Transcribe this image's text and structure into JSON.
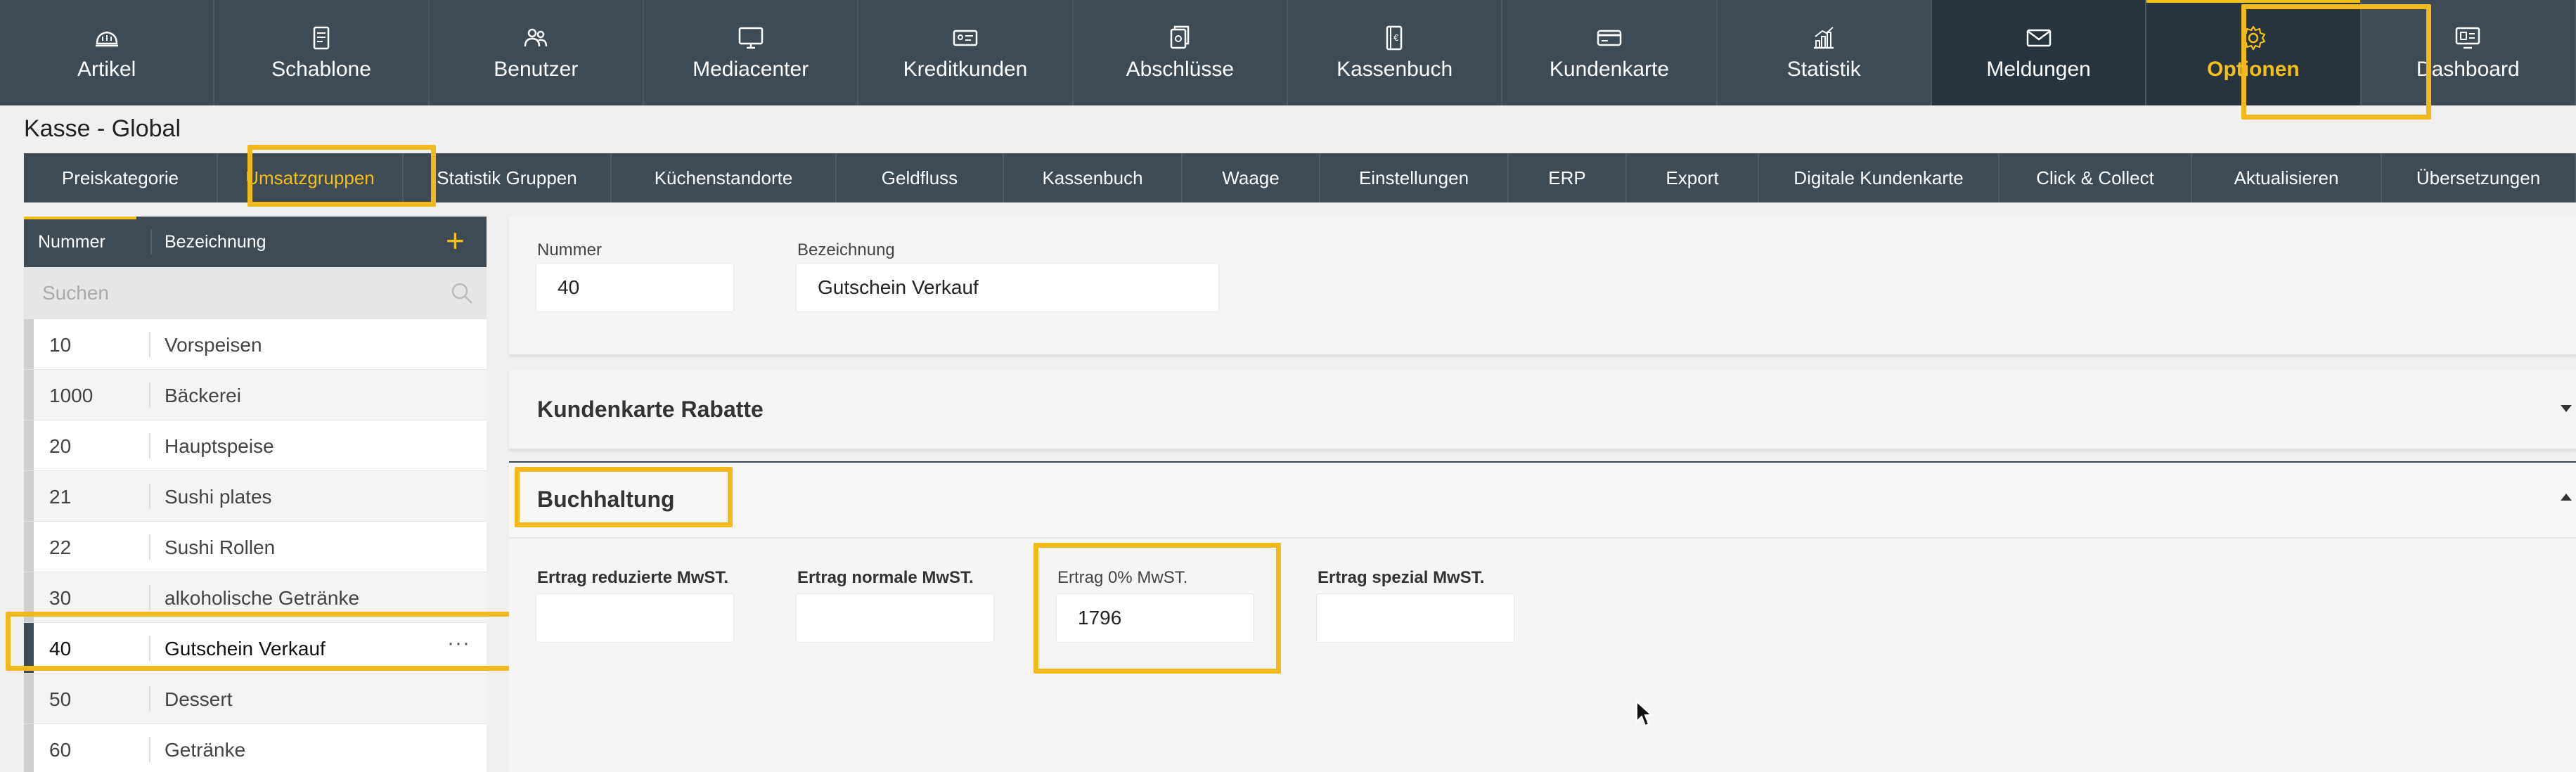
{
  "topnav": {
    "items": [
      {
        "label": "Artikel",
        "icon": "bread-icon"
      },
      {
        "label": "Schablone",
        "icon": "template-icon"
      },
      {
        "label": "Benutzer",
        "icon": "users-icon"
      },
      {
        "label": "Mediacenter",
        "icon": "monitor-icon"
      },
      {
        "label": "Kreditkunden",
        "icon": "id-card-icon"
      },
      {
        "label": "Abschlüsse",
        "icon": "files-icon"
      },
      {
        "label": "Kassenbuch",
        "icon": "cashbook-icon"
      },
      {
        "label": "Kundenkarte",
        "icon": "card-icon"
      },
      {
        "label": "Statistik",
        "icon": "chart-icon"
      },
      {
        "label": "Meldungen",
        "icon": "envelope-icon"
      },
      {
        "label": "Optionen",
        "icon": "gear-icon"
      },
      {
        "label": "Dashboard",
        "icon": "dashboard-icon"
      }
    ],
    "active_index": 10
  },
  "page_title": "Kasse - Global",
  "subtabs": [
    "Preiskategorie",
    "Umsatzgruppen",
    "Statistik Gruppen",
    "Küchenstandorte",
    "Geldfluss",
    "Kassenbuch",
    "Waage",
    "Einstellungen",
    "ERP",
    "Export",
    "Digitale Kundenkarte",
    "Click & Collect",
    "Aktualisieren",
    "Übersetzungen"
  ],
  "subtabs_active_index": 1,
  "list": {
    "header_number": "Nummer",
    "header_name": "Bezeichnung",
    "add_label": "+",
    "search_placeholder": "Suchen",
    "rows": [
      {
        "number": "10",
        "name": "Vorspeisen"
      },
      {
        "number": "1000",
        "name": "Bäckerei"
      },
      {
        "number": "20",
        "name": "Hauptspeise"
      },
      {
        "number": "21",
        "name": "Sushi plates"
      },
      {
        "number": "22",
        "name": "Sushi Rollen"
      },
      {
        "number": "30",
        "name": "alkoholische Getränke"
      },
      {
        "number": "40",
        "name": "Gutschein Verkauf"
      },
      {
        "number": "50",
        "name": "Dessert"
      },
      {
        "number": "60",
        "name": "Getränke"
      }
    ],
    "selected_index": 6,
    "row_menu": "···"
  },
  "detail": {
    "number_label": "Nummer",
    "number_value": "40",
    "name_label": "Bezeichnung",
    "name_value": "Gutschein Verkauf"
  },
  "kundenkarte": {
    "title": "Kundenkarte Rabatte"
  },
  "buchhaltung": {
    "title": "Buchhaltung",
    "fields": [
      {
        "label": "Ertrag reduzierte MwST.",
        "value": ""
      },
      {
        "label": "Ertrag normale MwST.",
        "value": ""
      },
      {
        "label": "Ertrag 0% MwST.",
        "value": "1796"
      },
      {
        "label": "Ertrag spezial MwST.",
        "value": ""
      }
    ]
  },
  "colors": {
    "accent": "#f2c01a",
    "nav_bg": "#3e4a54",
    "highlight": "#f2b91c"
  }
}
